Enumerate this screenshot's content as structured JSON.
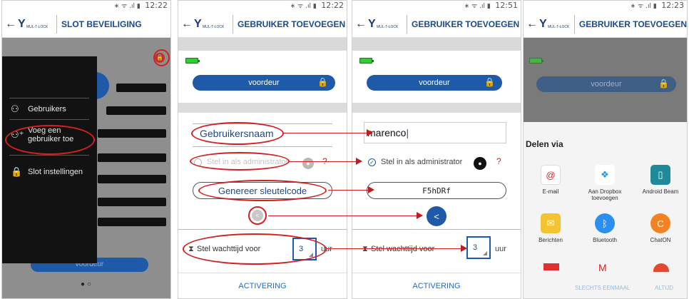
{
  "screens": [
    {
      "status": {
        "icons": "∗ ᯤ .ıl ▮",
        "time": "12:22"
      },
      "header": {
        "back_icon": "←",
        "brand": "MUL-T-LOCK",
        "title": "SLOT BEVEILIGING"
      },
      "drawer": [
        {
          "icon": "user-icon",
          "label": "Gebruikers"
        },
        {
          "icon": "add-user-icon",
          "label": "Voeg een gebruiker toe"
        },
        {
          "icon": "lock-settings-icon",
          "label": "Slot instellingen"
        }
      ],
      "background_lock_label": "voordeur"
    },
    {
      "status": {
        "icons": "∗ ᯤ .ıl ▮",
        "time": "12:22"
      },
      "header": {
        "back_icon": "←",
        "brand": "MUL-T-LOCK",
        "title": "GEBRUIKER TOEVOEGEN"
      },
      "lock_label": "voordeur",
      "username_placeholder": "Gebruikersnaam",
      "admin_label": "Stel in als administrator",
      "question": "?",
      "generate_label": "Genereer sleutelcode",
      "wait_label": "Stel wachttijd voor",
      "wait_value": "3",
      "wait_unit": "uur",
      "activate": "ACTIVERING"
    },
    {
      "status": {
        "icons": "∗ ᯤ .ıl ▮",
        "time": "12:51"
      },
      "header": {
        "back_icon": "←",
        "brand": "MUL-T-LOCK",
        "title": "GEBRUIKER TOEVOEGEN"
      },
      "lock_label": "voordeur",
      "username_value": "marenco",
      "admin_label": "Stel in als administrator",
      "question": "?",
      "code_value": "F5hDRf",
      "wait_label": "Stel wachttijd voor",
      "wait_value": "3",
      "wait_unit": "uur",
      "activate": "ACTIVERING"
    },
    {
      "status": {
        "icons": "∗ ᯤ .ıl ▮",
        "time": "12:23"
      },
      "header": {
        "back_icon": "←",
        "brand": "MUL-T-LOCK",
        "title": "GEBRUIKER TOEVOEGEN"
      },
      "lock_label": "voordeur",
      "share_title": "Delen via",
      "apps": [
        {
          "icon": "email-icon",
          "label": "E-mail",
          "color": "#ffffff"
        },
        {
          "icon": "dropbox-icon",
          "label": "Aan Dropbox toevoegen",
          "color": "#ffffff"
        },
        {
          "icon": "android-beam-icon",
          "label": "Android Beam",
          "color": "#1f8a9a"
        },
        {
          "icon": "messages-icon",
          "label": "Berichten",
          "color": "#f4c430"
        },
        {
          "icon": "bluetooth-icon",
          "label": "Bluetooth",
          "color": "#2a8ff0"
        },
        {
          "icon": "chaton-icon",
          "label": "ChatON",
          "color": "#f58220"
        }
      ],
      "once": "SLECHTS EENMAAL",
      "always": "ALTIJD"
    }
  ],
  "colors": {
    "primary": "#1e5aa8",
    "annotation": "#d42020",
    "battery": "#33cc33"
  }
}
